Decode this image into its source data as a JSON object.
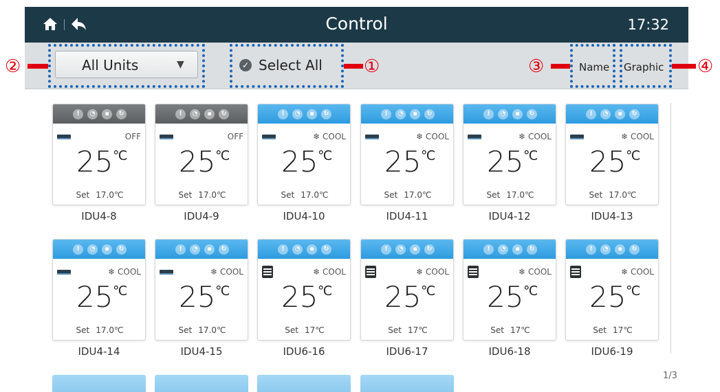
{
  "header": {
    "title": "Control",
    "time": "17:32",
    "home_icon": "home-icon",
    "back_icon": "back-arrow-icon"
  },
  "toolbar": {
    "units_select": {
      "selected": "All Units",
      "icon": "caret-down-icon"
    },
    "select_all": {
      "label": "Select All",
      "icon": "check-circle-icon"
    },
    "view_name": "Name",
    "view_graphic": "Graphic"
  },
  "annotations": {
    "select_all": "①",
    "units": "②",
    "name": "③",
    "graphic": "④"
  },
  "status_icons": [
    "alarm-icon",
    "clock-icon",
    "lock-icon",
    "cycle-icon"
  ],
  "pagination": "1/3",
  "set_label": "Set",
  "temp_unit": "℃",
  "units": [
    {
      "name": "IDU4-8",
      "temp": "25",
      "mode": "OFF",
      "set": "17.0℃",
      "power": "off",
      "device": "wall-unit-icon"
    },
    {
      "name": "IDU4-9",
      "temp": "25",
      "mode": "OFF",
      "set": "17.0℃",
      "power": "off",
      "device": "wall-unit-icon"
    },
    {
      "name": "IDU4-10",
      "temp": "25",
      "mode": "❄ COOL",
      "set": "17.0℃",
      "power": "on",
      "device": "wall-unit-icon"
    },
    {
      "name": "IDU4-11",
      "temp": "25",
      "mode": "❄ COOL",
      "set": "17.0℃",
      "power": "on",
      "device": "wall-unit-icon"
    },
    {
      "name": "IDU4-12",
      "temp": "25",
      "mode": "❄ COOL",
      "set": "17.0℃",
      "power": "on",
      "device": "wall-unit-icon"
    },
    {
      "name": "IDU4-13",
      "temp": "25",
      "mode": "❄ COOL",
      "set": "17.0℃",
      "power": "on",
      "device": "wall-unit-icon"
    },
    {
      "name": "IDU4-14",
      "temp": "25",
      "mode": "❄ COOL",
      "set": "17.0℃",
      "power": "on",
      "device": "wall-unit-icon"
    },
    {
      "name": "IDU4-15",
      "temp": "25",
      "mode": "❄ COOL",
      "set": "17.0℃",
      "power": "on",
      "device": "wall-unit-icon"
    },
    {
      "name": "IDU6-16",
      "temp": "25",
      "mode": "❄ COOL",
      "set": "17℃",
      "power": "on",
      "device": "grille-unit-icon"
    },
    {
      "name": "IDU6-17",
      "temp": "25",
      "mode": "❄ COOL",
      "set": "17℃",
      "power": "on",
      "device": "grille-unit-icon"
    },
    {
      "name": "IDU6-18",
      "temp": "25",
      "mode": "❄ COOL",
      "set": "17℃",
      "power": "on",
      "device": "grille-unit-icon"
    },
    {
      "name": "IDU6-19",
      "temp": "25",
      "mode": "❄ COOL",
      "set": "17℃",
      "power": "on",
      "device": "grille-unit-icon"
    }
  ]
}
